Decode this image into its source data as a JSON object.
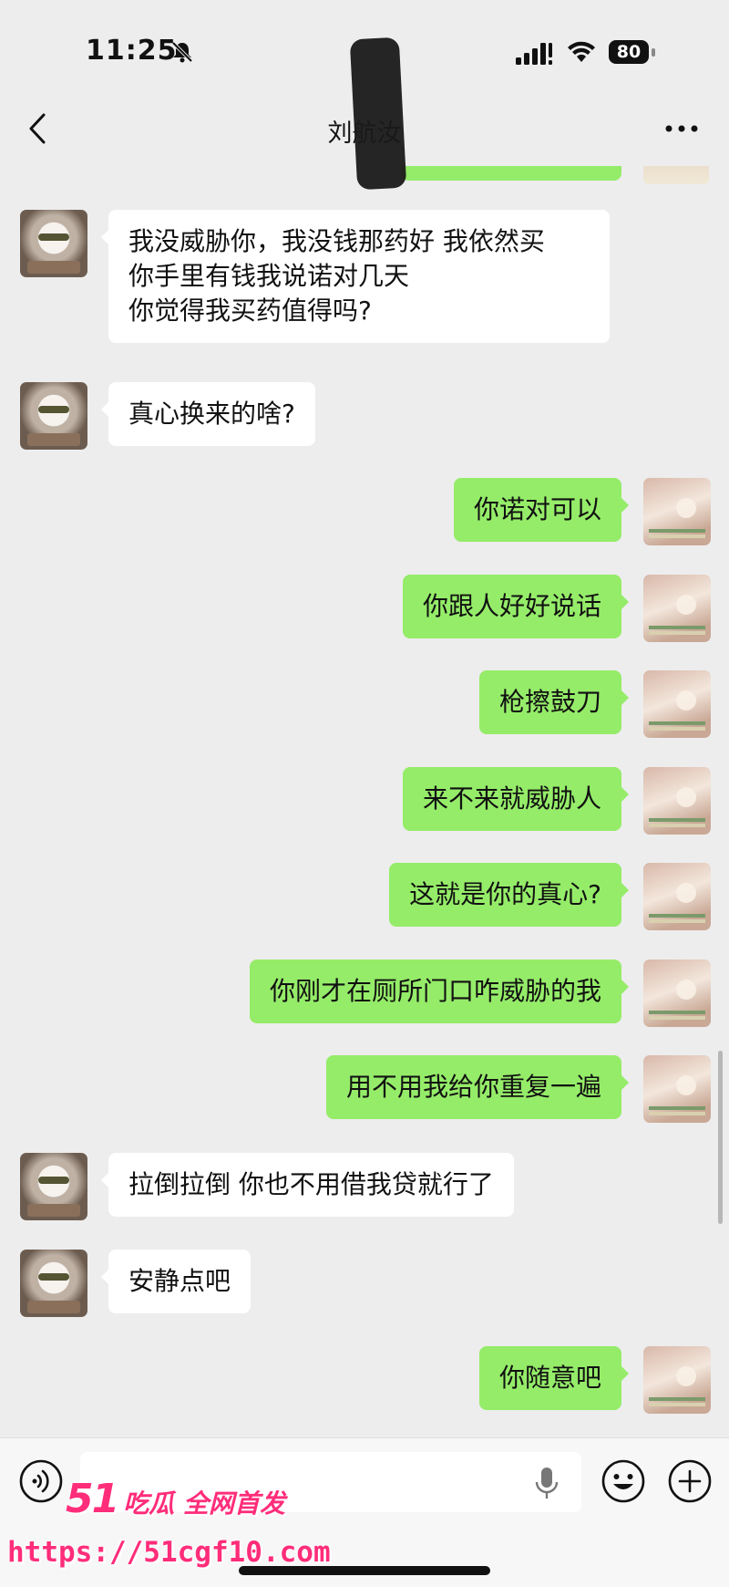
{
  "status_bar": {
    "time": "11:25",
    "battery": "80"
  },
  "nav": {
    "title": "刘航汝"
  },
  "messages": [
    {
      "side": "left",
      "text": "我没威胁你，我没钱那药好 我依然买\n你手里有钱我说诺对几天\n你觉得我买药值得吗?"
    },
    {
      "side": "left",
      "text": "真心换来的啥?"
    },
    {
      "side": "right",
      "text": "你诺对可以"
    },
    {
      "side": "right",
      "text": "你跟人好好说话"
    },
    {
      "side": "right",
      "text": "枪擦鼓刀"
    },
    {
      "side": "right",
      "text": "来不来就威胁人"
    },
    {
      "side": "right",
      "text": "这就是你的真心?"
    },
    {
      "side": "right",
      "text": "你刚才在厕所门口咋威胁的我"
    },
    {
      "side": "right",
      "text": "用不用我给你重复一遍"
    },
    {
      "side": "left",
      "text": "拉倒拉倒 你也不用借我贷就行了"
    },
    {
      "side": "left",
      "text": "安静点吧"
    },
    {
      "side": "right",
      "text": "你随意吧"
    }
  ],
  "input": {
    "value": "",
    "placeholder": ""
  },
  "watermark": {
    "brand_num": "51",
    "brand_text": "吃瓜 全网首发",
    "url": "https://51cgf10.com"
  },
  "colors": {
    "background": "#ededed",
    "bubble_sent": "#95ec69",
    "bubble_received": "#ffffff",
    "watermark": "#ff2d7a"
  },
  "icons": [
    "bell-off-icon",
    "signal-icon",
    "wifi-icon",
    "battery-icon",
    "back-icon",
    "more-icon",
    "voice-icon",
    "mic-icon",
    "emoji-icon",
    "plus-icon"
  ]
}
